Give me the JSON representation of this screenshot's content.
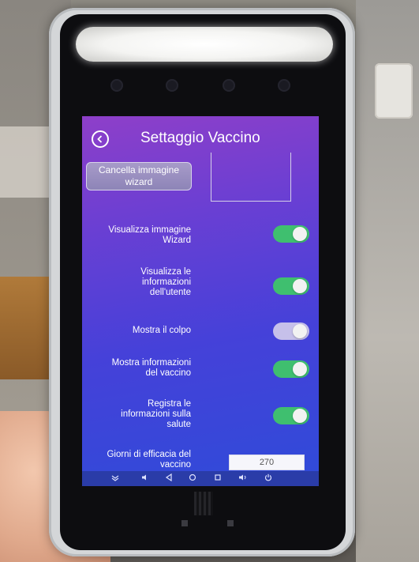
{
  "header": {
    "title": "Settaggio Vaccino",
    "back_icon": "chevron-left-icon"
  },
  "wizard": {
    "button_line1": "Cancella immagine",
    "button_line2": "wizard"
  },
  "settings": [
    {
      "lines": [
        "Visualizza immagine",
        "Wizard"
      ],
      "enabled": true
    },
    {
      "lines": [
        "Visualizza le",
        "informazioni",
        "dell'utente"
      ],
      "enabled": true
    },
    {
      "lines": [
        "Mostra il colpo"
      ],
      "enabled": false
    },
    {
      "lines": [
        "Mostra informazioni",
        "del vaccino"
      ],
      "enabled": true
    },
    {
      "lines": [
        "Registra le",
        "informazioni sulla",
        "salute"
      ],
      "enabled": true
    }
  ],
  "efficacy": {
    "label_line1": "Giorni di efficacia del",
    "label_line2": "vaccino",
    "value": "270"
  },
  "navbar": {
    "icons": [
      "expand-icon",
      "volume-down-icon",
      "back-icon",
      "home-icon",
      "recents-icon",
      "volume-up-icon",
      "power-icon"
    ]
  },
  "colors": {
    "toggle_on": "#3fbf6f",
    "toggle_off": "#c6c0ea",
    "screen_top": "#8e3fc9",
    "screen_bottom": "#2f4bd9"
  }
}
